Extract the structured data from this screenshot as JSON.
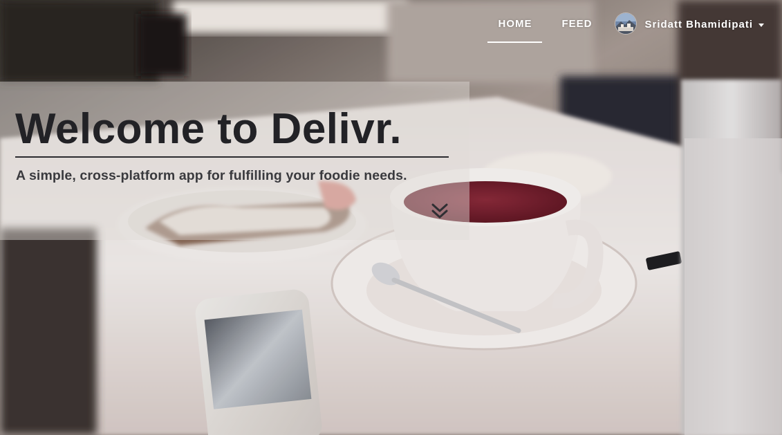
{
  "nav": {
    "home_label": "HOME",
    "feed_label": "FEED",
    "user_name": "Sridatt Bhamidipati",
    "user_caret_icon": "caret-down-icon",
    "avatar_icon": "user-avatar"
  },
  "hero": {
    "title": "Welcome to Delivr.",
    "subtitle": "A simple, cross-platform app for fulfilling your foodie needs.",
    "scroll_icon": "double-chevron-down-icon"
  },
  "colors": {
    "title_text": "#222226",
    "subtitle_text": "#3a3a3e",
    "nav_text": "#ffffff"
  }
}
